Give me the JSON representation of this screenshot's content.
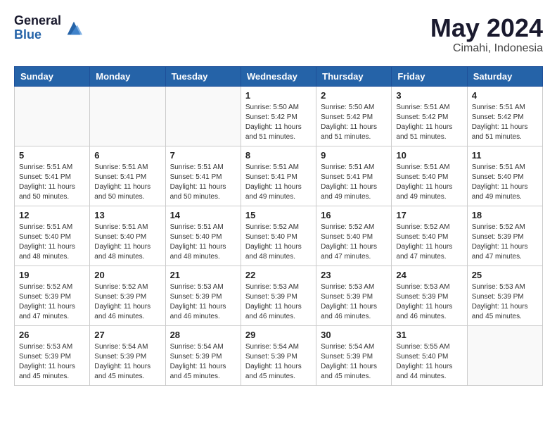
{
  "logo": {
    "general": "General",
    "blue": "Blue"
  },
  "title": {
    "month": "May 2024",
    "location": "Cimahi, Indonesia"
  },
  "weekdays": [
    "Sunday",
    "Monday",
    "Tuesday",
    "Wednesday",
    "Thursday",
    "Friday",
    "Saturday"
  ],
  "weeks": [
    [
      {
        "day": "",
        "info": ""
      },
      {
        "day": "",
        "info": ""
      },
      {
        "day": "",
        "info": ""
      },
      {
        "day": "1",
        "info": "Sunrise: 5:50 AM\nSunset: 5:42 PM\nDaylight: 11 hours\nand 51 minutes."
      },
      {
        "day": "2",
        "info": "Sunrise: 5:50 AM\nSunset: 5:42 PM\nDaylight: 11 hours\nand 51 minutes."
      },
      {
        "day": "3",
        "info": "Sunrise: 5:51 AM\nSunset: 5:42 PM\nDaylight: 11 hours\nand 51 minutes."
      },
      {
        "day": "4",
        "info": "Sunrise: 5:51 AM\nSunset: 5:42 PM\nDaylight: 11 hours\nand 51 minutes."
      }
    ],
    [
      {
        "day": "5",
        "info": "Sunrise: 5:51 AM\nSunset: 5:41 PM\nDaylight: 11 hours\nand 50 minutes."
      },
      {
        "day": "6",
        "info": "Sunrise: 5:51 AM\nSunset: 5:41 PM\nDaylight: 11 hours\nand 50 minutes."
      },
      {
        "day": "7",
        "info": "Sunrise: 5:51 AM\nSunset: 5:41 PM\nDaylight: 11 hours\nand 50 minutes."
      },
      {
        "day": "8",
        "info": "Sunrise: 5:51 AM\nSunset: 5:41 PM\nDaylight: 11 hours\nand 49 minutes."
      },
      {
        "day": "9",
        "info": "Sunrise: 5:51 AM\nSunset: 5:41 PM\nDaylight: 11 hours\nand 49 minutes."
      },
      {
        "day": "10",
        "info": "Sunrise: 5:51 AM\nSunset: 5:40 PM\nDaylight: 11 hours\nand 49 minutes."
      },
      {
        "day": "11",
        "info": "Sunrise: 5:51 AM\nSunset: 5:40 PM\nDaylight: 11 hours\nand 49 minutes."
      }
    ],
    [
      {
        "day": "12",
        "info": "Sunrise: 5:51 AM\nSunset: 5:40 PM\nDaylight: 11 hours\nand 48 minutes."
      },
      {
        "day": "13",
        "info": "Sunrise: 5:51 AM\nSunset: 5:40 PM\nDaylight: 11 hours\nand 48 minutes."
      },
      {
        "day": "14",
        "info": "Sunrise: 5:51 AM\nSunset: 5:40 PM\nDaylight: 11 hours\nand 48 minutes."
      },
      {
        "day": "15",
        "info": "Sunrise: 5:52 AM\nSunset: 5:40 PM\nDaylight: 11 hours\nand 48 minutes."
      },
      {
        "day": "16",
        "info": "Sunrise: 5:52 AM\nSunset: 5:40 PM\nDaylight: 11 hours\nand 47 minutes."
      },
      {
        "day": "17",
        "info": "Sunrise: 5:52 AM\nSunset: 5:40 PM\nDaylight: 11 hours\nand 47 minutes."
      },
      {
        "day": "18",
        "info": "Sunrise: 5:52 AM\nSunset: 5:39 PM\nDaylight: 11 hours\nand 47 minutes."
      }
    ],
    [
      {
        "day": "19",
        "info": "Sunrise: 5:52 AM\nSunset: 5:39 PM\nDaylight: 11 hours\nand 47 minutes."
      },
      {
        "day": "20",
        "info": "Sunrise: 5:52 AM\nSunset: 5:39 PM\nDaylight: 11 hours\nand 46 minutes."
      },
      {
        "day": "21",
        "info": "Sunrise: 5:53 AM\nSunset: 5:39 PM\nDaylight: 11 hours\nand 46 minutes."
      },
      {
        "day": "22",
        "info": "Sunrise: 5:53 AM\nSunset: 5:39 PM\nDaylight: 11 hours\nand 46 minutes."
      },
      {
        "day": "23",
        "info": "Sunrise: 5:53 AM\nSunset: 5:39 PM\nDaylight: 11 hours\nand 46 minutes."
      },
      {
        "day": "24",
        "info": "Sunrise: 5:53 AM\nSunset: 5:39 PM\nDaylight: 11 hours\nand 46 minutes."
      },
      {
        "day": "25",
        "info": "Sunrise: 5:53 AM\nSunset: 5:39 PM\nDaylight: 11 hours\nand 45 minutes."
      }
    ],
    [
      {
        "day": "26",
        "info": "Sunrise: 5:53 AM\nSunset: 5:39 PM\nDaylight: 11 hours\nand 45 minutes."
      },
      {
        "day": "27",
        "info": "Sunrise: 5:54 AM\nSunset: 5:39 PM\nDaylight: 11 hours\nand 45 minutes."
      },
      {
        "day": "28",
        "info": "Sunrise: 5:54 AM\nSunset: 5:39 PM\nDaylight: 11 hours\nand 45 minutes."
      },
      {
        "day": "29",
        "info": "Sunrise: 5:54 AM\nSunset: 5:39 PM\nDaylight: 11 hours\nand 45 minutes."
      },
      {
        "day": "30",
        "info": "Sunrise: 5:54 AM\nSunset: 5:39 PM\nDaylight: 11 hours\nand 45 minutes."
      },
      {
        "day": "31",
        "info": "Sunrise: 5:55 AM\nSunset: 5:40 PM\nDaylight: 11 hours\nand 44 minutes."
      },
      {
        "day": "",
        "info": ""
      }
    ]
  ]
}
